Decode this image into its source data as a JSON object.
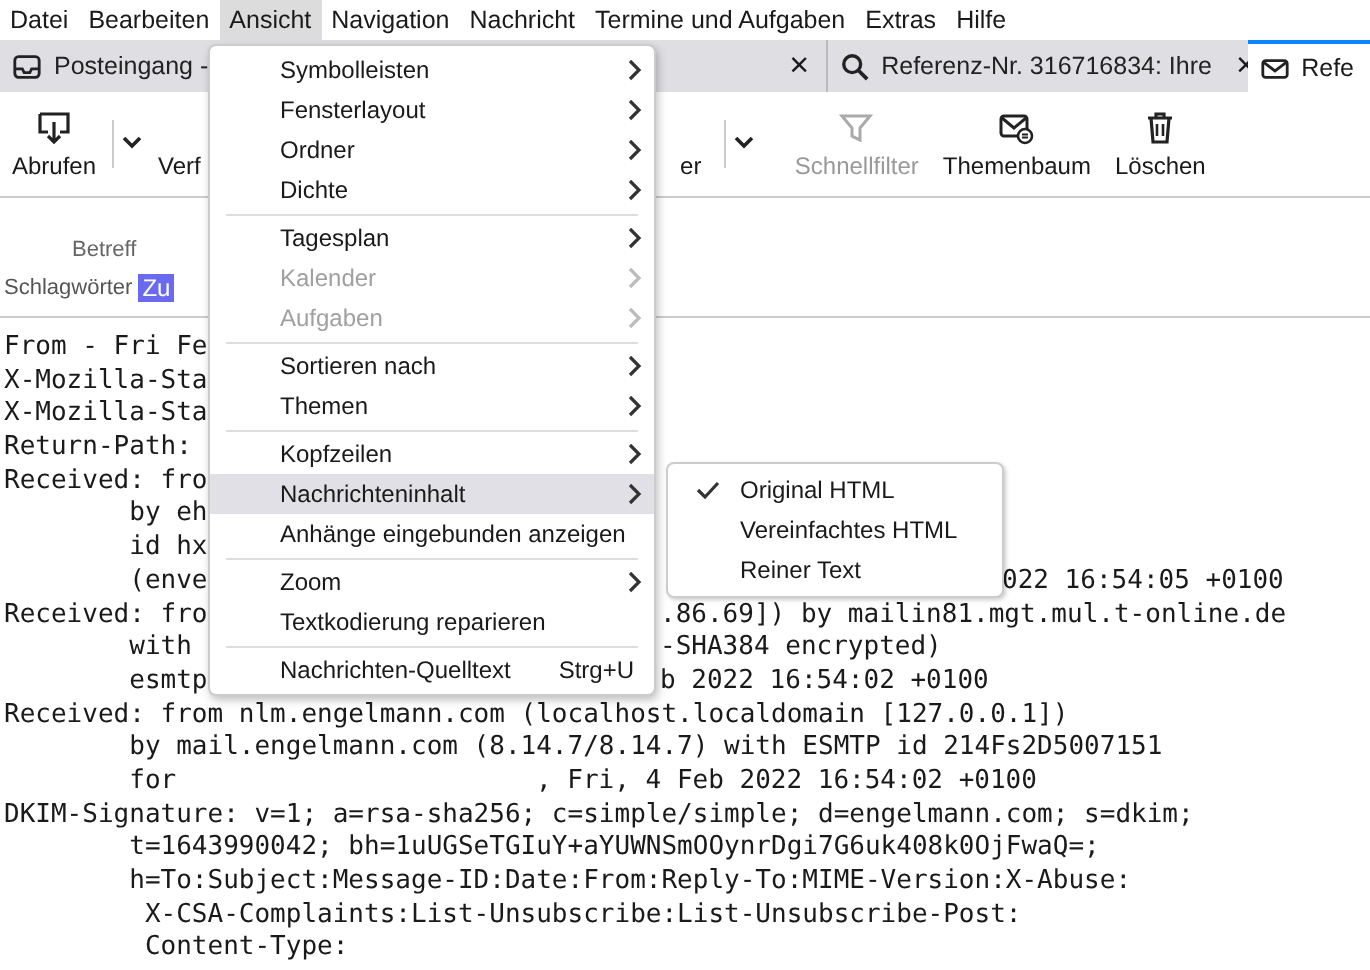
{
  "menubar": [
    {
      "label": "Datei",
      "selected": false
    },
    {
      "label": "Bearbeiten",
      "selected": false
    },
    {
      "label": "Ansicht",
      "selected": true
    },
    {
      "label": "Navigation",
      "selected": false
    },
    {
      "label": "Nachricht",
      "selected": false
    },
    {
      "label": "Termine und Aufgaben",
      "selected": false
    },
    {
      "label": "Extras",
      "selected": false
    },
    {
      "label": "Hilfe",
      "selected": false
    }
  ],
  "tabs": [
    {
      "kind": "inbox",
      "label": "Posteingang -",
      "close": "×",
      "selected": false
    },
    {
      "kind": "search",
      "label": "Referenz-Nr. 316716834: Ihre",
      "close": "×",
      "selected": false
    },
    {
      "kind": "mail",
      "label": "Refe",
      "selected": true
    }
  ],
  "toolbar": [
    {
      "kind": "get",
      "label": "Abrufen",
      "dropdown": true,
      "disabled": false
    },
    {
      "kind": "write",
      "label": "Verf",
      "dropdown": false,
      "disabled": false
    },
    {
      "kind": "plain",
      "label": "er",
      "dropdown": true,
      "disabled": false
    },
    {
      "kind": "filter",
      "label": "Schnellfilter",
      "dropdown": false,
      "disabled": true
    },
    {
      "kind": "thread",
      "label": "Themenbaum",
      "dropdown": false,
      "disabled": false
    },
    {
      "kind": "trash",
      "label": "Löschen",
      "dropdown": false,
      "disabled": false
    }
  ],
  "header": {
    "subject_label": "Betreff",
    "tags_label": "Schlagwörter",
    "tag": "Zu"
  },
  "source": [
    {
      "left": "From - Fri Fe"
    },
    {
      "left": "X-Mozilla-Sta"
    },
    {
      "left": "X-Mozilla-Sta"
    },
    {
      "left": "Return-Path:"
    },
    {
      "left": "Received: fro"
    },
    {
      "left": "        by eh"
    },
    {
      "left": "        id hx"
    },
    {
      "left": "        (enve",
      "right": "022 16:54:05 +0100",
      "far": true
    },
    {
      "left": "Received: fro",
      "right": ".86.69]) by mailin81.mgt.mul.t-online.de"
    },
    {
      "left": "        with",
      "right": "-SHA384 encrypted)"
    },
    {
      "left": "        esmtp",
      "right": "b 2022 16:54:02 +0100"
    },
    {
      "left": "Received: from nlm.engelmann.com (localhost.localdomain [127.0.0.1])"
    },
    {
      "left": "        by mail.engelmann.com (8.14.7/8.14.7) with ESMTP id 214Fs2D5007151"
    },
    {
      "left": "        for",
      "right": ", Fri, 4 Feb 2022 16:54:02 +0100",
      "mid": true
    },
    {
      "left": "DKIM-Signature: v=1; a=rsa-sha256; c=simple/simple; d=engelmann.com; s=dkim;"
    },
    {
      "left": "        t=1643990042; bh=1uUGSeTGIuY+aYUWNSmOOynrDgi7G6uk408k0OjFwaQ=;"
    },
    {
      "left": "        h=To:Subject:Message-ID:Date:From:Reply-To:MIME-Version:X-Abuse:"
    },
    {
      "left": "         X-CSA-Complaints:List-Unsubscribe:List-Unsubscribe-Post:"
    },
    {
      "left": "         Content-Type:"
    }
  ],
  "menu": [
    {
      "kind": "submenu",
      "label": "Symbolleisten",
      "disabled": false,
      "selected": false
    },
    {
      "kind": "submenu",
      "label": "Fensterlayout",
      "disabled": false,
      "selected": false
    },
    {
      "kind": "submenu",
      "label": "Ordner",
      "disabled": false,
      "selected": false
    },
    {
      "kind": "submenu",
      "label": "Dichte",
      "disabled": false,
      "selected": false
    },
    {
      "kind": "separator"
    },
    {
      "kind": "submenu",
      "label": "Tagesplan",
      "disabled": false,
      "selected": false
    },
    {
      "kind": "submenu",
      "label": "Kalender",
      "disabled": true,
      "selected": false
    },
    {
      "kind": "submenu",
      "label": "Aufgaben",
      "disabled": true,
      "selected": false
    },
    {
      "kind": "separator"
    },
    {
      "kind": "submenu",
      "label": "Sortieren nach",
      "disabled": false,
      "selected": false
    },
    {
      "kind": "submenu",
      "label": "Themen",
      "disabled": false,
      "selected": false
    },
    {
      "kind": "separator"
    },
    {
      "kind": "submenu",
      "label": "Kopfzeilen",
      "disabled": false,
      "selected": false
    },
    {
      "kind": "submenu",
      "label": "Nachrichteninhalt",
      "disabled": false,
      "selected": true
    },
    {
      "kind": "item",
      "label": "Anhänge eingebunden anzeigen",
      "disabled": false,
      "selected": false
    },
    {
      "kind": "separator"
    },
    {
      "kind": "submenu",
      "label": "Zoom",
      "disabled": false,
      "selected": false
    },
    {
      "kind": "item",
      "label": "Textkodierung reparieren",
      "disabled": false,
      "selected": false
    },
    {
      "kind": "separator"
    },
    {
      "kind": "item",
      "label": "Nachrichten-Quelltext",
      "shortcut": "Strg+U",
      "disabled": false,
      "selected": false
    }
  ],
  "submenu": [
    {
      "label": "Original HTML",
      "checked": true
    },
    {
      "label": "Vereinfachtes HTML",
      "checked": false
    },
    {
      "label": "Reiner Text",
      "checked": false
    }
  ]
}
